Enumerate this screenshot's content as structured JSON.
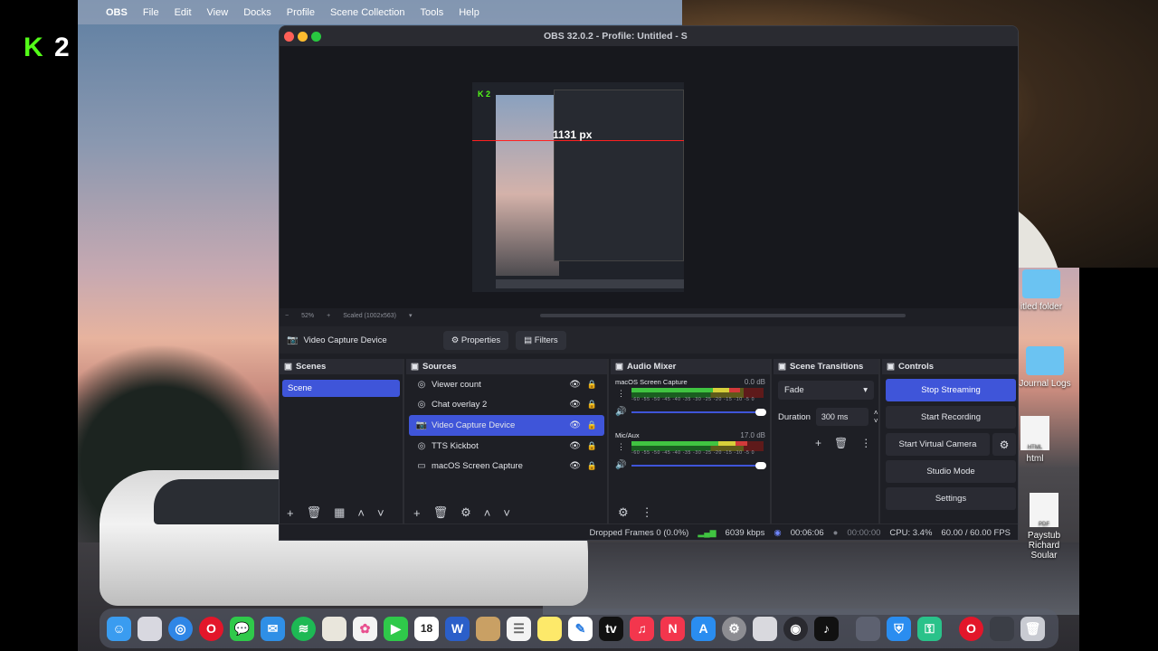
{
  "menubar": {
    "app_name": "OBS",
    "items": [
      "File",
      "Edit",
      "View",
      "Docks",
      "Profile",
      "Scene Collection",
      "Tools",
      "Help"
    ]
  },
  "logo": {
    "text": "2"
  },
  "window": {
    "title": "OBS 32.0.2 - Profile: Untitled - S"
  },
  "preview": {
    "guide_label": "1131 px",
    "zoom": "52%",
    "scale_mode": "Scaled (1002x563)"
  },
  "source_toolbar": {
    "selected_source": "Video Capture Device",
    "properties_label": "Properties",
    "filters_label": "Filters"
  },
  "scenes": {
    "header": "Scenes",
    "items": [
      "Scene"
    ]
  },
  "sources": {
    "header": "Sources",
    "items": [
      {
        "name": "Viewer count",
        "icon": "globe-icon"
      },
      {
        "name": "Chat overlay 2",
        "icon": "globe-icon"
      },
      {
        "name": "Video Capture Device",
        "icon": "camera-icon"
      },
      {
        "name": "TTS Kickbot",
        "icon": "globe-icon"
      },
      {
        "name": "macOS Screen Capture",
        "icon": "monitor-icon"
      }
    ]
  },
  "mixer": {
    "header": "Audio Mixer",
    "channels": [
      {
        "name": "macOS Screen Capture",
        "db": "0.0 dB",
        "level": 0.82
      },
      {
        "name": "Mic/Aux",
        "db": "17.0 dB",
        "level": 0.88
      }
    ],
    "scale": "-60 -55 -50 -45 -40 -35 -30 -25 -20 -15 -10 -5 0"
  },
  "transitions": {
    "header": "Scene Transitions",
    "selected": "Fade",
    "duration_label": "Duration",
    "duration_value": "300 ms"
  },
  "controls": {
    "header": "Controls",
    "stop_streaming": "Stop Streaming",
    "start_recording": "Start Recording",
    "start_virtual_camera": "Start Virtual Camera",
    "studio_mode": "Studio Mode",
    "settings": "Settings"
  },
  "status": {
    "dropped_frames": "Dropped Frames 0 (0.0%)",
    "bitrate": "6039 kbps",
    "stream_time": "00:06:06",
    "record_time": "00:00:00",
    "cpu": "CPU: 3.4%",
    "fps": "60.00 / 60.00 FPS"
  },
  "desktop_items": {
    "folder1": "itled folder",
    "folder2": "Journal Logs",
    "file1": "html",
    "file2_line1": "Paystub Richard",
    "file2_line2": "Soular"
  },
  "dock": {
    "calendar_day": "18"
  }
}
